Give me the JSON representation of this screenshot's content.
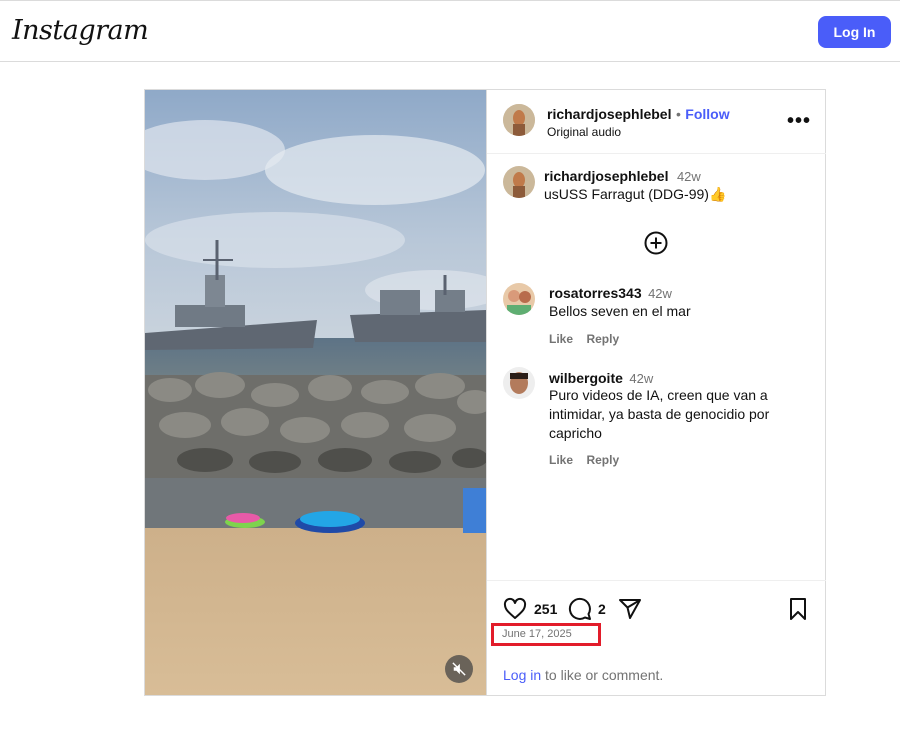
{
  "header": {
    "logo": "Instagram",
    "login_label": "Log In"
  },
  "post": {
    "author": "richardjosephlebel",
    "separator": "•",
    "follow_label": "Follow",
    "audio": "Original audio",
    "caption": {
      "user": "richardjosephlebel",
      "time": "42w",
      "text": "usUSS Farragut (DDG-99)"
    },
    "comments": [
      {
        "user": "rosatorres343",
        "time": "42w",
        "text": "Bellos seven en el mar",
        "like_label": "Like",
        "reply_label": "Reply"
      },
      {
        "user": "wilbergoite",
        "time": "42w",
        "text": "Puro videos de IA, creen que van a intimidar, ya basta de genocidio por capricho",
        "like_label": "Like",
        "reply_label": "Reply"
      }
    ],
    "likes": "251",
    "comment_count": "2",
    "date": "June 17, 2025",
    "login_link": "Log in",
    "login_suffix": " to like or comment."
  },
  "colors": {
    "accent": "#4a5df9",
    "highlight": "#e21c2a"
  },
  "icons": [
    "more-options-icon",
    "add-comment-icon",
    "heart-icon",
    "comment-icon",
    "share-icon",
    "bookmark-icon",
    "mute-icon",
    "thumbs-up-emoji"
  ]
}
